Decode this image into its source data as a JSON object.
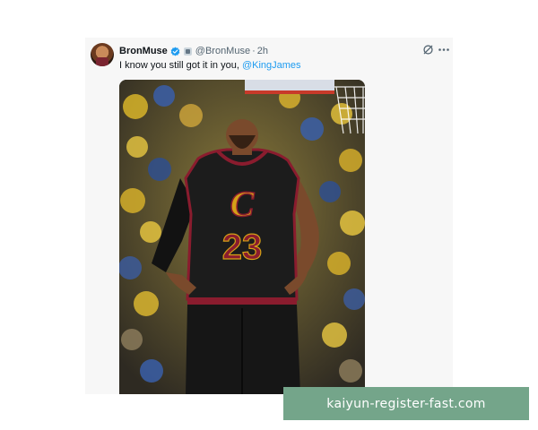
{
  "tweet": {
    "display_name": "BronMuse",
    "handle": "@BronMuse",
    "separator": "·",
    "timestamp": "2h",
    "text_before": "I know you still got it in you, ",
    "mention": "@KingJames",
    "verified_color": "#1d9bf0",
    "icons": [
      "verified-icon",
      "grok-icon",
      "more-icon"
    ]
  },
  "media": {
    "jersey_team": "C",
    "jersey_number": "23",
    "jersey_color": "#1c1c1c",
    "trim_color": "#8a1c2e",
    "accent_color": "#d4a017"
  },
  "watermark": {
    "text": "kaiyun-register-fast.com",
    "color": "#74a58a"
  }
}
